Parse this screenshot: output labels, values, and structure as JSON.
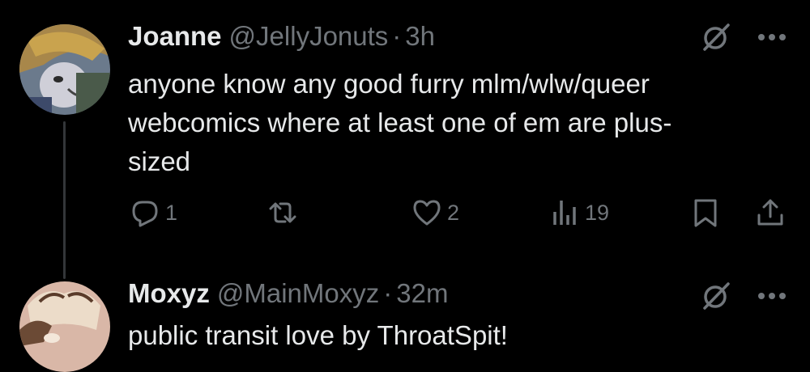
{
  "tweets": [
    {
      "name": "Joanne",
      "handle": "@JellyJonuts",
      "separator": "·",
      "time": "3h",
      "text_lines": [
        "anyone know any good furry mlm/wlw/queer",
        "webcomics where at least one of em are plus-",
        "sized"
      ],
      "actions": {
        "replies": "1",
        "retweets": "",
        "likes": "2",
        "views": "19"
      }
    },
    {
      "name": "Moxyz",
      "handle": "@MainMoxyz",
      "separator": "·",
      "time": "32m",
      "text_lines": [
        "public transit love by ThroatSpit!"
      ]
    }
  ],
  "icons": {
    "reply": "reply-icon",
    "retweet": "retweet-icon",
    "like": "heart-icon",
    "views": "views-icon",
    "bookmark": "bookmark-icon",
    "share": "share-icon",
    "grok": "grok-icon",
    "more": "more-icon"
  },
  "colors": {
    "background": "#000000",
    "primary_text": "#e7e9ea",
    "secondary_text": "#71767b",
    "thread_line": "#333639"
  }
}
